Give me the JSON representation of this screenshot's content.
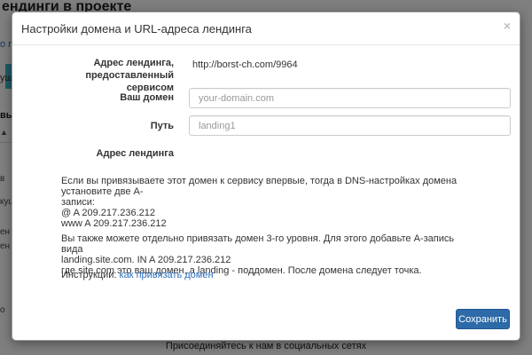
{
  "background": {
    "title": "ендинги в проекте",
    "link_text": "о проект",
    "band_text": "ущ",
    "nav_text": "вы",
    "caret": "▲",
    "snippets": [
      "в",
      "кущ",
      "ен",
      "ен",
      "о"
    ],
    "footer_text": "Присоединяйтесь к нам в социальных сетях"
  },
  "modal": {
    "title": "Настройки домена и URL-адреса лендинга",
    "close_glyph": "×",
    "service_address_label_line1": "Адрес лендинга,",
    "service_address_label_line2": "предоставленный сервисом",
    "service_address_value": "http://borst-ch.com/9964",
    "domain_label": "Ваш домен",
    "domain_placeholder": "your-domain.com",
    "domain_value": "",
    "path_label": "Путь",
    "path_placeholder": "landing1",
    "path_value": "",
    "landing_address_label": "Адрес лендинга",
    "info_line1": "Если вы привязываете этот домен к сервису впервые, тогда в DNS-настройках домена установите две А-",
    "info_line2": "записи:",
    "info_line3": "@ A 209.217.236.212",
    "info_line4": "www A 209.217.236.212",
    "info_line5": "Вы также можете отдельно привязать домен 3-го уровня. Для этого добавьте А-запись вида",
    "info_line6": "landing.site.com. IN A 209.217.236.212",
    "info_line7": "где site.com это ваш домен, а landing - поддомен. После домена следует точка.",
    "instructions_label": "Инструкции:",
    "instructions_link": "как привязать домен",
    "save_label": "Сохранить"
  },
  "colors": {
    "primary_button": "#2c6aa8",
    "link": "#2a6ebb",
    "overlay": "rgba(0,0,0,0.5)"
  }
}
